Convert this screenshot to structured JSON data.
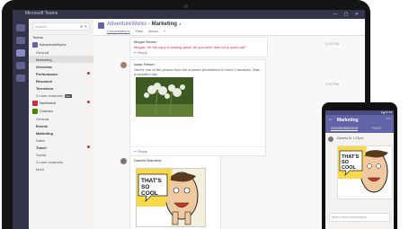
{
  "window": {
    "title": "Microsoft Teams",
    "controls": "— ▢ ✕"
  },
  "sidebar": {
    "search_placeholder": "Search",
    "search_icons": "⊕ ✎",
    "section_label": "Teams",
    "items": [
      {
        "label": "AdventureWorks",
        "kind": "team",
        "color": "#6264a7"
      },
      {
        "label": "General",
        "kind": "channel"
      },
      {
        "label": "Marketing",
        "kind": "channel",
        "selected": true
      },
      {
        "label": "Overview",
        "kind": "channel",
        "bold": true
      },
      {
        "label": "Performance",
        "kind": "channel",
        "bold": true,
        "alert": true
      },
      {
        "label": "Research",
        "kind": "channel",
        "bold": true
      },
      {
        "label": "Television",
        "kind": "channel",
        "bold": true
      },
      {
        "label": "3 more channels",
        "kind": "channel",
        "badge": "New"
      },
      {
        "label": "Northwind",
        "kind": "team",
        "color": "#c4314b",
        "alert": true
      },
      {
        "label": "Contoso",
        "kind": "team",
        "color": "#498205"
      },
      {
        "label": "General",
        "kind": "channel"
      },
      {
        "label": "Events",
        "kind": "channel",
        "bold": true
      },
      {
        "label": "Marketing",
        "kind": "channel",
        "bold": true
      },
      {
        "label": "Sales",
        "kind": "channel"
      },
      {
        "label": "Travel",
        "kind": "channel",
        "bold": true,
        "alert": true
      },
      {
        "label": "Social",
        "kind": "channel"
      },
      {
        "label": "3 more channels",
        "kind": "channel"
      },
      {
        "label": "More",
        "kind": "more"
      }
    ]
  },
  "channel": {
    "team": "AdventureWorks",
    "separator": " › ",
    "name": "Marketing",
    "star": "★",
    "menu": "···",
    "tabs": [
      "Conversations",
      "Files",
      "Notes",
      "+"
    ]
  },
  "messages": [
    {
      "author": "Megan Bowen",
      "text": "Megan: Hi! the copy is looking great. do you have time for a quick call?",
      "reply": "↩ Reply",
      "time": "2:16 PM"
    },
    {
      "author": "Isaac Fielder",
      "text": "Here's one of the photos from the summer photoshoot in North Cascades. Was a beautiful day.",
      "reply": "↩ Reply",
      "time": "2:20 PM"
    },
    {
      "author": "Daniela Mandera",
      "comic_text": "THAT'S SO COOL",
      "time": "2:25 PM"
    }
  ],
  "phone": {
    "status": "▾◢ 12:30",
    "back": "←",
    "title": "Marketing",
    "more": "⋯",
    "tabs": [
      "CONVERSATIONS",
      "FILES"
    ],
    "author": "Daniela M.  1:21pm",
    "comic_text": "THAT'S SO COOL",
    "compose_placeholder": "Start a new conversation"
  }
}
